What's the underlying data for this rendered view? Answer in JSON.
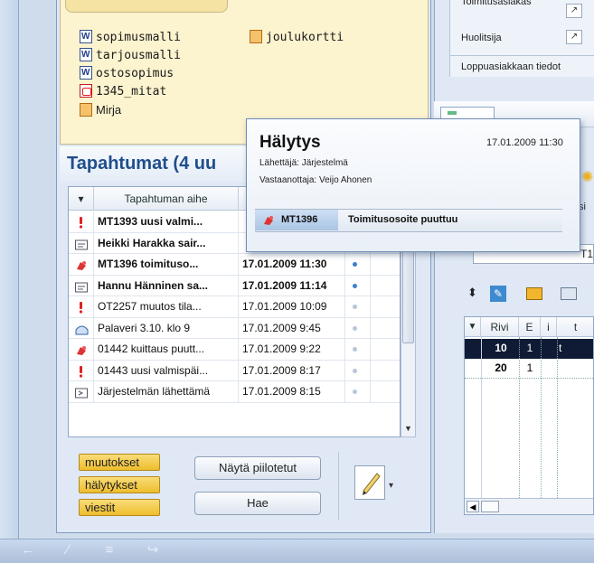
{
  "documents": [
    {
      "name": "sopimusmalli",
      "icon": "word-doc-icon"
    },
    {
      "name": "tarjousmalli",
      "icon": "word-doc-icon"
    },
    {
      "name": "ostosopimus",
      "icon": "word-doc-icon"
    },
    {
      "name": "1345_mitat",
      "icon": "pdf-icon"
    },
    {
      "name": "Mirja",
      "icon": "publisher-doc-icon"
    },
    {
      "name": "joulukortti",
      "icon": "publisher-doc-icon"
    }
  ],
  "events": {
    "title": "Tapahtumat (4 uu",
    "columns": {
      "subject": "Tapahtuman aihe"
    },
    "rows": [
      {
        "icon": "exclamation-icon",
        "subject": "MT1393 uusi valmi...",
        "time": "",
        "bold": true,
        "dot": ""
      },
      {
        "icon": "message-icon",
        "subject": "Heikki Harakka sair...",
        "time": "",
        "bold": true,
        "dot": ""
      },
      {
        "icon": "alert-icon",
        "subject": "MT1396 toimituso...",
        "time": "17.01.2009 11:30",
        "bold": true,
        "dot": "#3b7fd0"
      },
      {
        "icon": "message-icon",
        "subject": "Hannu Hänninen sa...",
        "time": "17.01.2009 11:14",
        "bold": true,
        "dot": "#3b7fd0"
      },
      {
        "icon": "exclamation-icon",
        "subject": "OT2257 muutos tila...",
        "time": "17.01.2009 10:09",
        "bold": false,
        "dot": "#b8c6d8"
      },
      {
        "icon": "meeting-icon",
        "subject": "Palaveri 3.10. klo 9",
        "time": "17.01.2009 9:45",
        "bold": false,
        "dot": "#b8c6d8"
      },
      {
        "icon": "alert-icon",
        "subject": "01442 kuittaus puutt...",
        "time": "17.01.2009 9:22",
        "bold": false,
        "dot": "#b8c6d8"
      },
      {
        "icon": "exclamation-icon",
        "subject": "01443 uusi valmispäi...",
        "time": "17.01.2009 8:17",
        "bold": false,
        "dot": "#b8c6d8"
      },
      {
        "icon": "system-message-icon",
        "subject": "Järjestelmän lähettämä",
        "time": "17.01.2009 8:15",
        "bold": false,
        "dot": "#b8c6d8"
      }
    ]
  },
  "filters": {
    "changes": "muutokset",
    "alerts": "hälytykset",
    "messages": "viestit"
  },
  "buttons": {
    "show_hidden": "Näytä piilotetut",
    "search": "Hae"
  },
  "right": {
    "labels": {
      "delivery_customer": "Toimitusasiakas",
      "forwarder": "Huolitsija",
      "end_customer": "Loppuasiakkaan tiedot"
    },
    "grid": {
      "headers": [
        "Rivi",
        "E",
        "i",
        "t"
      ],
      "rows": [
        {
          "rivi": "10",
          "e": "1",
          "i": "",
          "t": "t"
        },
        {
          "rivi": "20",
          "e": "1",
          "i": "",
          "t": ""
        }
      ],
      "partial_code": "T1",
      "partial_text": "si"
    }
  },
  "popup": {
    "title": "Hälytys",
    "date": "17.01.2009 11:30",
    "sender": "Lähettäjä: Järjestelmä",
    "recipient": "Vastaanottaja: Veijo Ahonen",
    "code": "MT1396",
    "message": "Toimitusosoite puuttuu"
  }
}
